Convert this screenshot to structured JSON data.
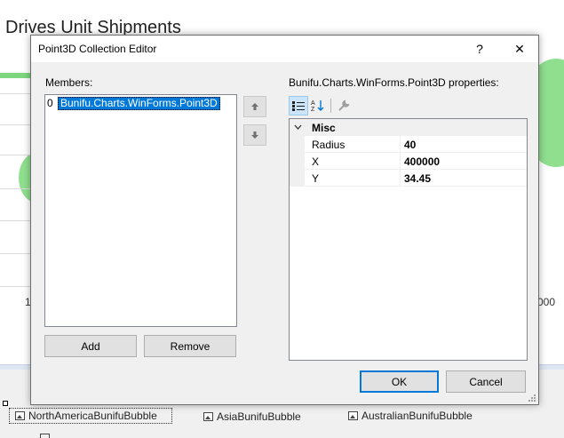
{
  "background": {
    "chart_title": "Drives Unit Shipments",
    "tick_left": "1",
    "tick_right": "000",
    "tray_items": [
      {
        "label": "NorthAmericaBunifuBubble",
        "icon": "component-icon"
      },
      {
        "label": "AsiaBunifuBubble",
        "icon": "component-icon"
      },
      {
        "label": "AustralianBunifuBubble",
        "icon": "component-icon"
      }
    ]
  },
  "dialog": {
    "title": "Point3D Collection Editor",
    "help_label": "?",
    "close_label": "✕",
    "members_label": "Members:",
    "members": [
      {
        "index": "0",
        "text": "Bunifu.Charts.WinForms.Point3D",
        "selected": true
      }
    ],
    "add_label": "Add",
    "remove_label": "Remove",
    "properties_label": "Bunifu.Charts.WinForms.Point3D properties:",
    "categories": [
      {
        "name": "Misc",
        "expanded": true,
        "properties": [
          {
            "name": "Radius",
            "value": "40"
          },
          {
            "name": "X",
            "value": "400000"
          },
          {
            "name": "Y",
            "value": "34.45"
          }
        ]
      }
    ],
    "ok_label": "OK",
    "cancel_label": "Cancel"
  },
  "colors": {
    "selection": "#0078d7",
    "bubble_green": "#8fdf8f",
    "dialog_bg": "#f0f0f0"
  }
}
